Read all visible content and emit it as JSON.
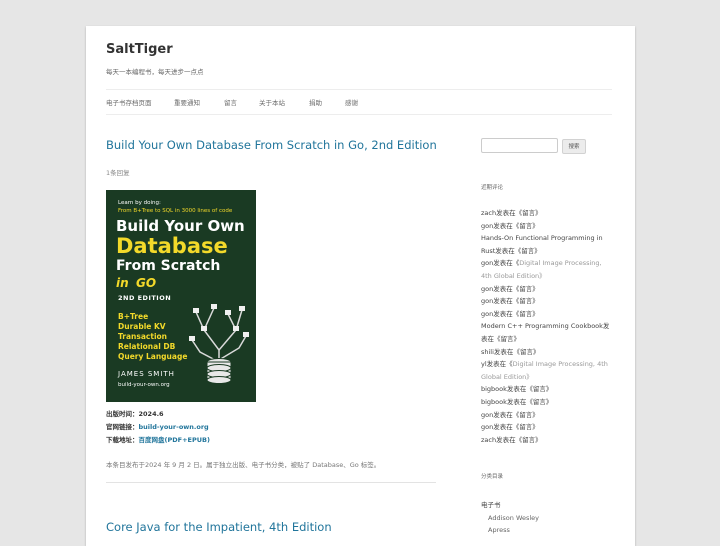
{
  "site": {
    "title": "SaltTiger",
    "description": "每天一本编程书，每天进步一点点"
  },
  "nav": [
    "电子书存档页面",
    "重要通知",
    "留言",
    "关于本站",
    "捐助",
    "感谢"
  ],
  "post": {
    "title": "Build Your Own Database From Scratch in Go, 2nd Edition",
    "comments_link": "1条回复",
    "cover": {
      "tagline1": "Learn by doing:",
      "tagline2": "From B+Tree to SQL in 3000 lines of code",
      "line1": "Build Your Own",
      "line2": "Database",
      "line3": "From Scratch",
      "line4": "in",
      "line4b": "GO",
      "edition": "2ND EDITION",
      "features": [
        "B+Tree",
        "Durable KV",
        "Transaction",
        "Relational DB",
        "Query Language"
      ],
      "author": "JAMES SMITH",
      "site": "build-your-own.org"
    },
    "meta": [
      {
        "label": "出版时间：",
        "value": "2024.6"
      },
      {
        "label": "官网链接：",
        "value": "build-your-own.org"
      },
      {
        "label": "下载地址：",
        "value": "百度网盘(PDF+EPUB)"
      }
    ],
    "footer": "本条目发布于2024 年 9 月 2 日。属于独立出版、电子书分类，被贴了 Database、Go 标签。"
  },
  "next_post": {
    "title": "Core Java for the Impatient, 4th Edition"
  },
  "sidebar": {
    "search_button": "搜索",
    "recent_comments_title": "近期评论",
    "recent_comments": [
      {
        "who": "zach发表在《",
        "what": "留言",
        "end": "》"
      },
      {
        "who": "gon发表在《",
        "what": "留言",
        "end": "》"
      },
      {
        "who": "Hands-On Functional Programming in Rust发表在《",
        "what": "留言",
        "end": "》"
      },
      {
        "who": "gon发表在《",
        "what": "Digital Image Processing, 4th Global Edition",
        "end": "》"
      },
      {
        "who": "gon发表在《",
        "what": "留言",
        "end": "》"
      },
      {
        "who": "gon发表在《",
        "what": "留言",
        "end": "》"
      },
      {
        "who": "gon发表在《",
        "what": "留言",
        "end": "》"
      },
      {
        "who": "Modern C++ Programming Cookbook发表在《",
        "what": "留言",
        "end": "》"
      },
      {
        "who": "shili发表在《",
        "what": "留言",
        "end": "》"
      },
      {
        "who": "yl发表在《",
        "what": "Digital Image Processing, 4th Global Edition",
        "end": "》"
      },
      {
        "who": "bigbook发表在《",
        "what": "留言",
        "end": "》"
      },
      {
        "who": "bigbook发表在《",
        "what": "留言",
        "end": "》"
      },
      {
        "who": "gon发表在《",
        "what": "留言",
        "end": "》"
      },
      {
        "who": "gon发表在《",
        "what": "留言",
        "end": "》"
      },
      {
        "who": "zach发表在《",
        "what": "留言",
        "end": "》"
      }
    ],
    "categories_title": "分类目录",
    "categories": {
      "top": "电子书",
      "children": [
        "Addison Wesley",
        "Apress"
      ]
    }
  },
  "colors": {
    "link": "#21759b",
    "background": "#e6e6e6",
    "cover_bg": "#1a3a23",
    "cover_accent": "#f3d92a"
  }
}
